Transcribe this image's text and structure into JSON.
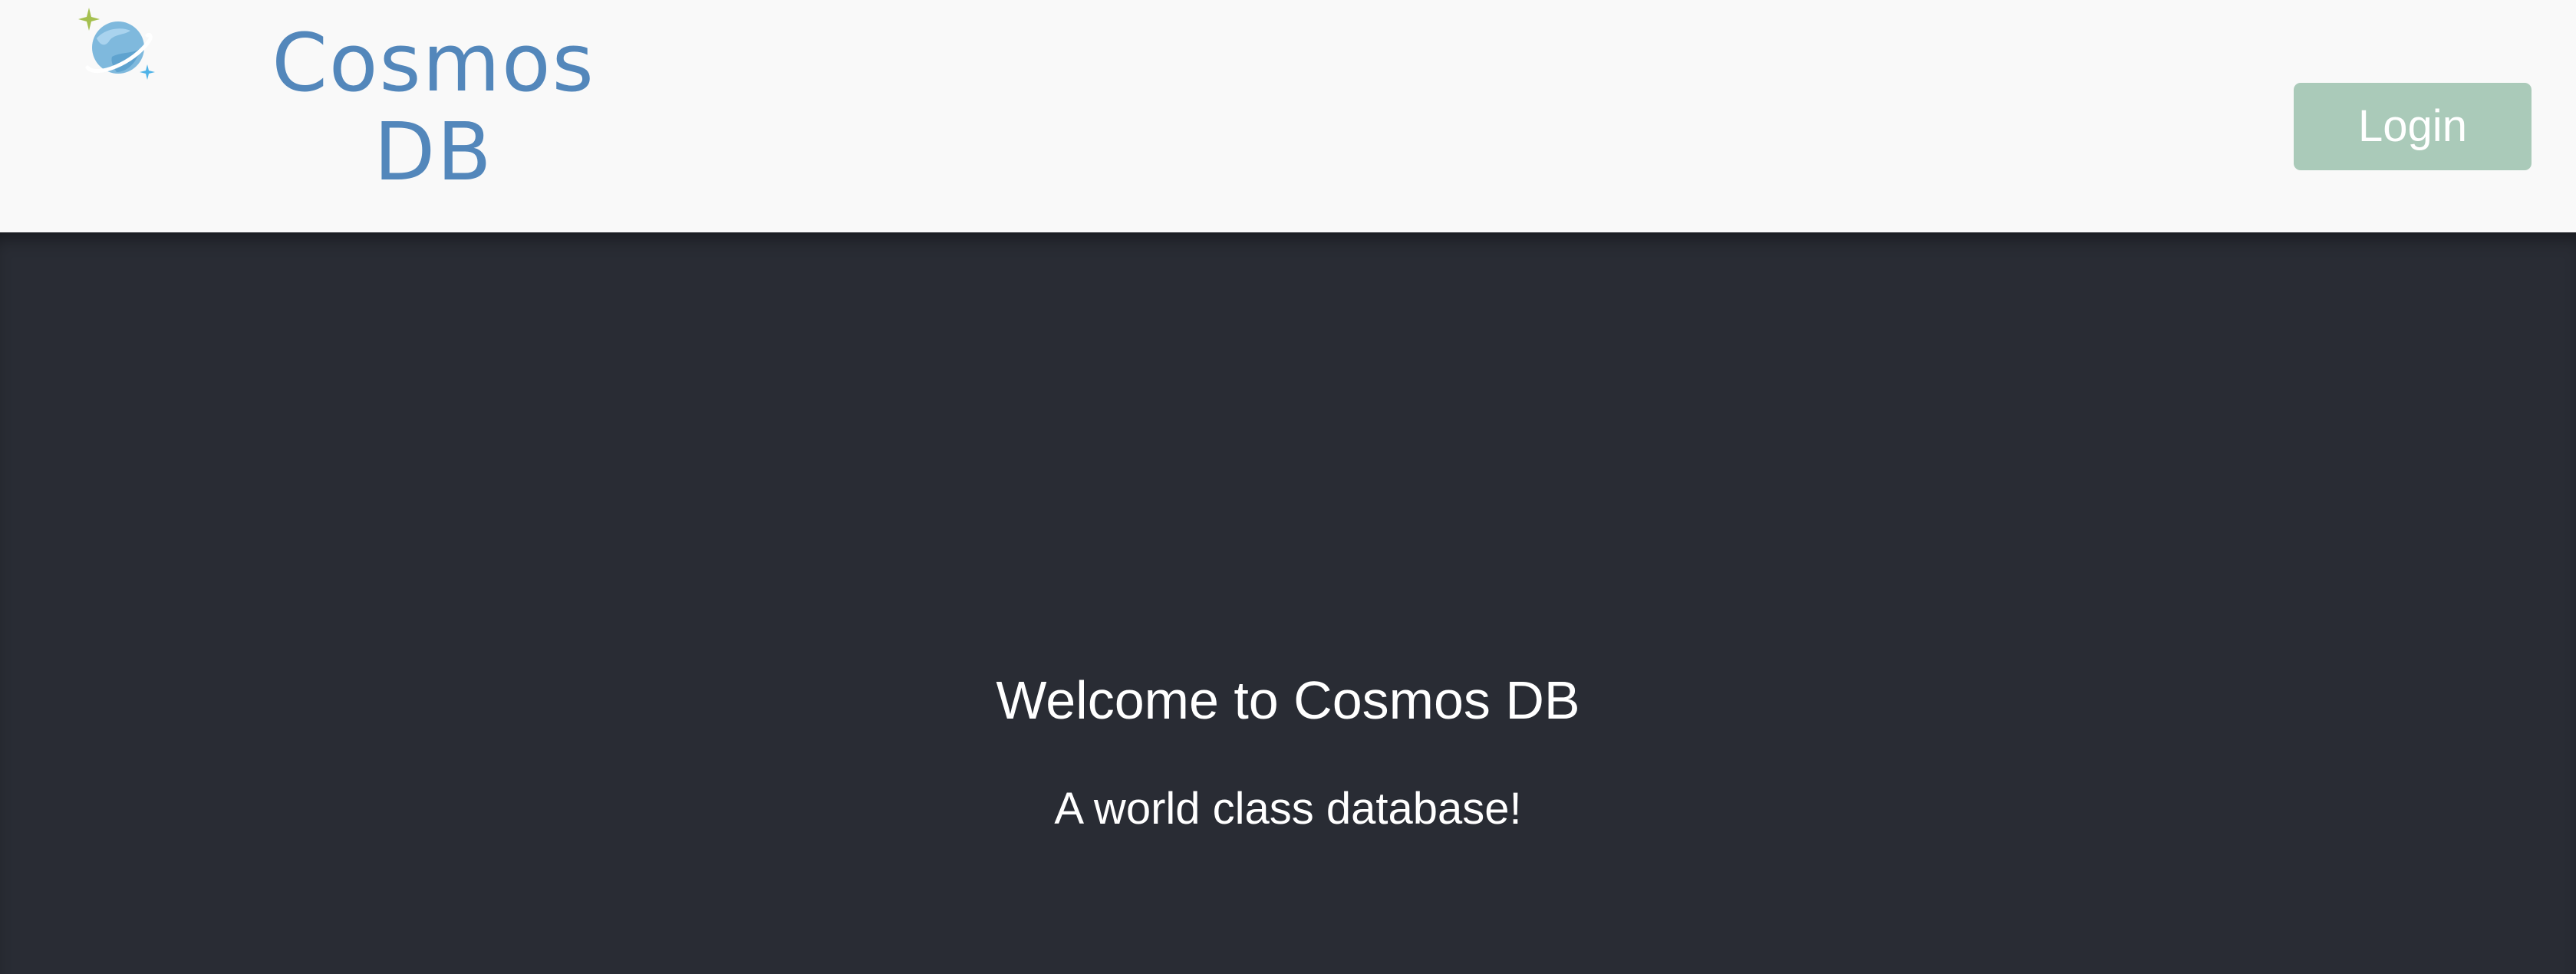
{
  "header": {
    "logo_icon": "cosmos-db-planet-icon",
    "brand_line1": "Cosmos",
    "brand_line2": "DB",
    "login_label": "Login"
  },
  "hero": {
    "title": "Welcome to Cosmos DB",
    "subtitle": "A world class database!"
  },
  "colors": {
    "header_bg": "#f9f9f9",
    "brand": "#5387bb",
    "login_bg": "#aacab9",
    "hero_bg": "#292c34",
    "hero_text": "#ffffff"
  }
}
